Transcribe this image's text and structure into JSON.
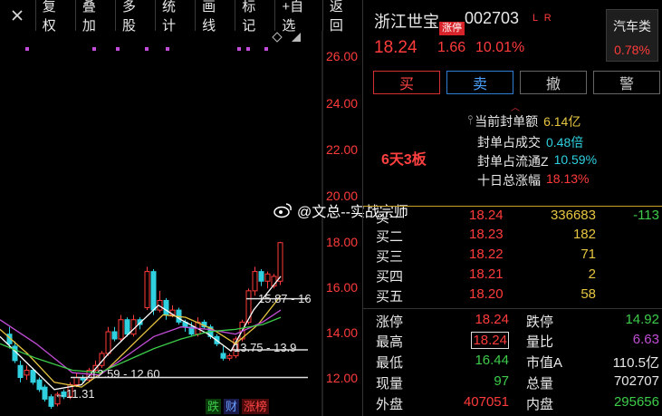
{
  "toolbar": {
    "buttons": [
      "复权",
      "叠加",
      "多股",
      "统计",
      "画线",
      "标记",
      "+自选",
      "返回"
    ]
  },
  "chart": {
    "y_ticks": [
      "26.00",
      "24.00",
      "22.00",
      "20.00",
      "18.00",
      "16.00",
      "14.00",
      "12.00"
    ],
    "board_label": "6天3板",
    "annotation_range_high": "15.87 - 16",
    "annotation_range_mid": "13.75 - 13.9",
    "annotation_range_low": "12.59 - 12.60",
    "annotation_low": "←11.31",
    "bottom_tags": [
      "跌",
      "财",
      "涨榜"
    ],
    "colors": {
      "up": "#ff3b3b",
      "down": "#2fd0e0",
      "ma5": "#ffffff",
      "ma10": "#e6c640",
      "ma20": "#c24dd6",
      "ma30": "#3dcc4a",
      "axis": "#ff3b3b"
    }
  },
  "chart_data": {
    "type": "candlestick",
    "ylim": [
      11,
      27
    ],
    "y_ticks": [
      12,
      14,
      16,
      18,
      20,
      22,
      24,
      26
    ]
  },
  "watermark": {
    "text": "@文总--实战宗师"
  },
  "quote": {
    "name": "浙江世宝",
    "limit_tag": "涨停",
    "code": "002703",
    "lr": "L R",
    "price": "18.24",
    "change": "1.66",
    "pct": "10.01%",
    "sector_name": "汽车类",
    "sector_pct": "0.78%"
  },
  "actions": {
    "buy": "买",
    "sell": "卖",
    "cancel": "撤",
    "alert": "警"
  },
  "seal": [
    {
      "label": "当前封单额",
      "value": "6.14亿",
      "color": "#e6c640"
    },
    {
      "label": "封单占成交",
      "value": "0.48倍",
      "color": "#2fd0e0"
    },
    {
      "label": "封单占流通Z",
      "value": "10.59%",
      "color": "#2fd0e0"
    },
    {
      "label": "十日总涨幅",
      "value": "18.13%",
      "color": "#ff3b3b"
    }
  ],
  "order_book": [
    {
      "label": "买一",
      "price": "18.24",
      "volume": "336683",
      "change": "-113"
    },
    {
      "label": "买二",
      "price": "18.23",
      "volume": "182",
      "change": ""
    },
    {
      "label": "买三",
      "price": "18.22",
      "volume": "71",
      "change": ""
    },
    {
      "label": "买四",
      "price": "18.21",
      "volume": "2",
      "change": ""
    },
    {
      "label": "买五",
      "price": "18.20",
      "volume": "58",
      "change": ""
    }
  ],
  "stats": [
    {
      "l1": "涨停",
      "v1": "18.24",
      "c1": "red",
      "l2": "跌停",
      "v2": "14.92",
      "c2": "green"
    },
    {
      "l1": "最高",
      "v1": "18.24",
      "c1": "red",
      "l2": "量比",
      "v2": "6.63",
      "c2": "purple"
    },
    {
      "l1": "最低",
      "v1": "16.44",
      "c1": "green",
      "l2": "市值A",
      "v2": "110.5亿",
      "c2": "white"
    },
    {
      "l1": "现量",
      "v1": "97",
      "c1": "green",
      "l2": "总量",
      "v2": "702707",
      "c2": "white"
    },
    {
      "l1": "外盘",
      "v1": "407051",
      "c1": "red",
      "l2": "内盘",
      "v2": "295656",
      "c2": "green"
    }
  ]
}
